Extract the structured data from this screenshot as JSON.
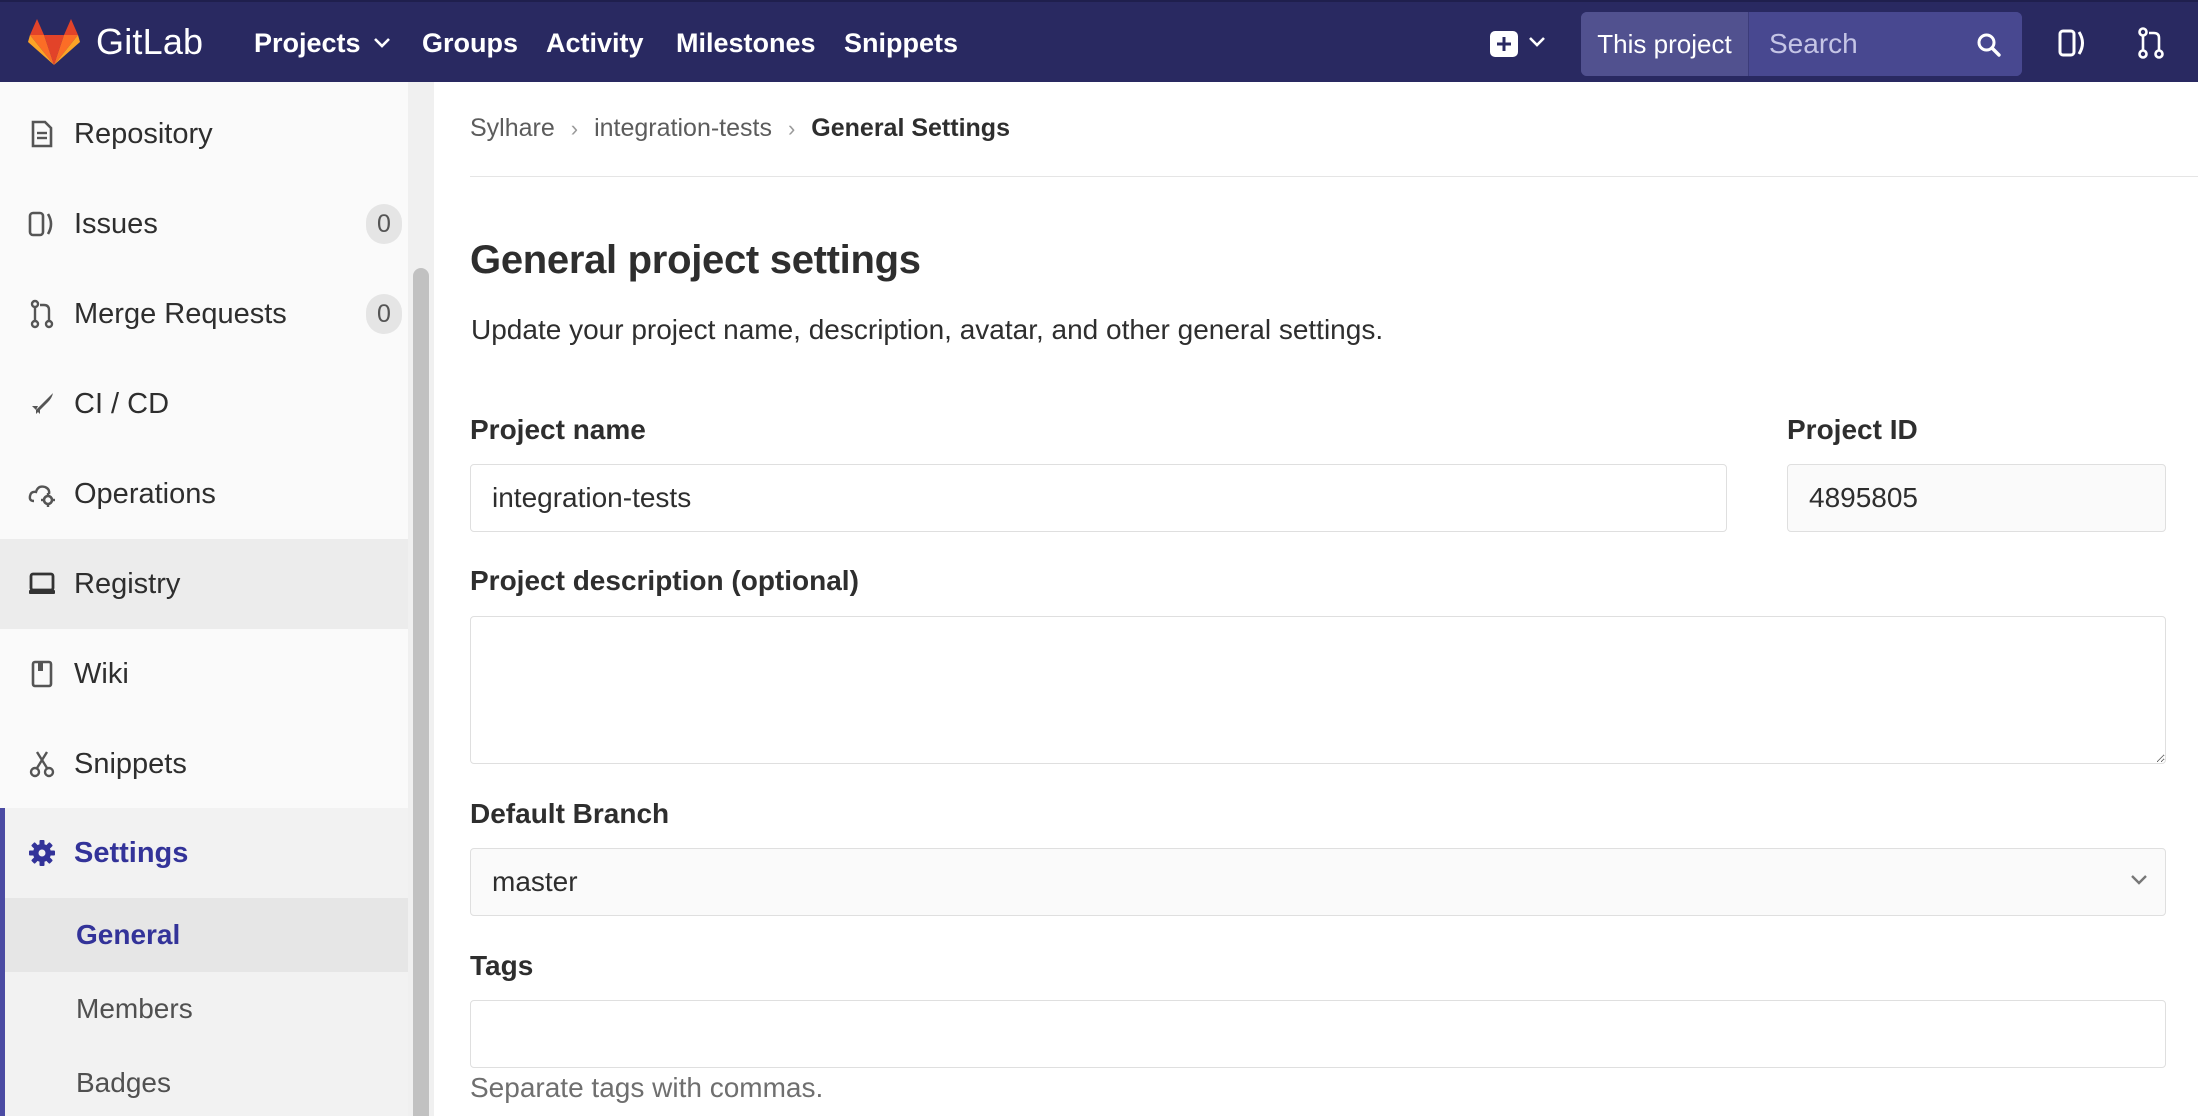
{
  "navbar": {
    "brand": "GitLab",
    "links": [
      "Projects",
      "Groups",
      "Activity",
      "Milestones",
      "Snippets"
    ],
    "search_scope": "This project",
    "search_placeholder": "Search"
  },
  "sidebar": {
    "items": [
      {
        "label": "Repository",
        "icon": "document-icon"
      },
      {
        "label": "Issues",
        "icon": "issues-icon",
        "badge": "0"
      },
      {
        "label": "Merge Requests",
        "icon": "merge-request-icon",
        "badge": "0"
      },
      {
        "label": "CI / CD",
        "icon": "rocket-icon"
      },
      {
        "label": "Operations",
        "icon": "cloud-gear-icon"
      },
      {
        "label": "Registry",
        "icon": "laptop-icon"
      },
      {
        "label": "Wiki",
        "icon": "book-icon"
      },
      {
        "label": "Snippets",
        "icon": "scissors-icon"
      },
      {
        "label": "Settings",
        "icon": "gear-icon"
      }
    ],
    "settings_subitems": [
      "General",
      "Members",
      "Badges"
    ]
  },
  "breadcrumb": [
    "Sylhare",
    "integration-tests",
    "General Settings"
  ],
  "main": {
    "title": "General project settings",
    "subtitle": "Update your project name, description, avatar, and other general settings.",
    "project_name_label": "Project name",
    "project_name_value": "integration-tests",
    "project_id_label": "Project ID",
    "project_id_value": "4895805",
    "description_label": "Project description (optional)",
    "description_value": "",
    "default_branch_label": "Default Branch",
    "default_branch_value": "master",
    "tags_label": "Tags",
    "tags_value": "",
    "tags_help": "Separate tags with commas."
  },
  "colors": {
    "navbar": "#292961",
    "accent": "#333399",
    "sidebar_bg": "#fafafa"
  }
}
